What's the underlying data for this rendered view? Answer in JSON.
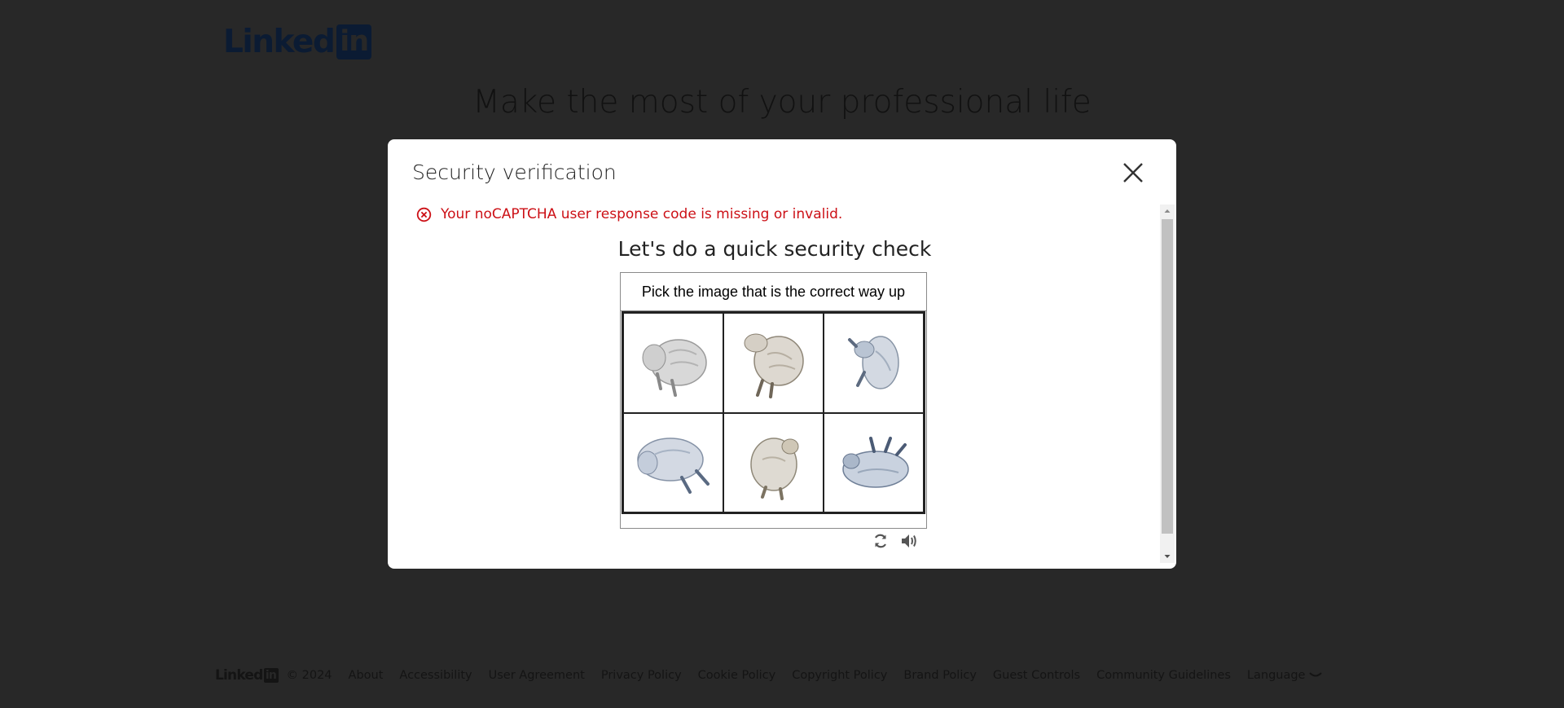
{
  "brand": {
    "logo_text": "Linked",
    "logo_box": "in"
  },
  "headline": "Make the most of your professional life",
  "modal": {
    "title": "Security verification",
    "close_icon": "close-icon",
    "error": "Your noCAPTCHA user response code is missing or invalid.",
    "check_title": "Let's do a quick security check",
    "captcha": {
      "prompt": "Pick the image that is the correct way up",
      "images": [
        {
          "icon": "animal-figure-icon",
          "orientation": "rotated"
        },
        {
          "icon": "animal-figure-icon",
          "orientation": "rotated"
        },
        {
          "icon": "animal-figure-icon",
          "orientation": "rotated"
        },
        {
          "icon": "animal-figure-icon",
          "orientation": "rotated"
        },
        {
          "icon": "animal-figure-icon",
          "orientation": "rotated"
        },
        {
          "icon": "animal-figure-icon",
          "orientation": "rotated"
        }
      ],
      "tools": [
        "refresh-icon",
        "audio-icon"
      ]
    }
  },
  "footer": {
    "logo_text": "Linked",
    "logo_box": "in",
    "copyright": "© 2024",
    "links": [
      "About",
      "Accessibility",
      "User Agreement",
      "Privacy Policy",
      "Cookie Policy",
      "Copyright Policy",
      "Brand Policy",
      "Guest Controls",
      "Community Guidelines"
    ],
    "language": "Language"
  },
  "colors": {
    "overlay_bg": "#282828",
    "error": "#cc1016",
    "modal_bg": "#ffffff"
  }
}
